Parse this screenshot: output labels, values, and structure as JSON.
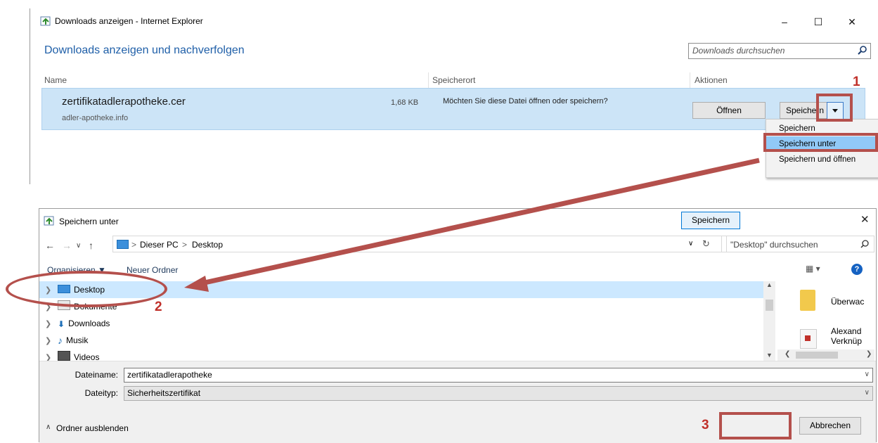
{
  "ie_window": {
    "title": "Downloads anzeigen - Internet Explorer",
    "heading": "Downloads anzeigen und nachverfolgen",
    "search_placeholder": "Downloads durchsuchen",
    "columns": {
      "name": "Name",
      "location": "Speicherort",
      "actions": "Aktionen"
    },
    "download": {
      "filename": "zertifikatadlerapotheke.cer",
      "site": "adler-apotheke.info",
      "size": "1,68 KB",
      "question": "Möchten Sie diese Datei öffnen oder speichern?",
      "open_label": "Öffnen",
      "save_label": "Speichern"
    },
    "dropdown": [
      "Speichern",
      "Speichern unter",
      "Speichern und öffnen"
    ]
  },
  "save_dialog": {
    "title": "Speichern unter",
    "address": {
      "pc": "Dieser PC",
      "sep1": ">",
      "sep2": ">",
      "folder": "Desktop"
    },
    "search_placeholder": "\"Desktop\" durchsuchen",
    "toolbar": {
      "organize": "Organisieren ▼",
      "new_folder": "Neuer Ordner"
    },
    "tree": [
      "Desktop",
      "Dokumente",
      "Downloads",
      "Musik",
      "Videos"
    ],
    "right_items": [
      "Überwac",
      "Alexand",
      "Verknüp"
    ],
    "filename_label": "Dateiname:",
    "filename_value": "zertifikatadlerapotheke",
    "filetype_label": "Dateityp:",
    "filetype_value": "Sicherheitszertifikat",
    "hide_folders": "Ordner ausblenden",
    "save_label": "Speichern",
    "cancel_label": "Abbrechen"
  },
  "annotations": {
    "step1": "1",
    "step2": "2",
    "step3": "3"
  },
  "colors": {
    "accent": "#1f5fa8",
    "annotation": "#b4504c",
    "selection": "#cce4f7"
  }
}
